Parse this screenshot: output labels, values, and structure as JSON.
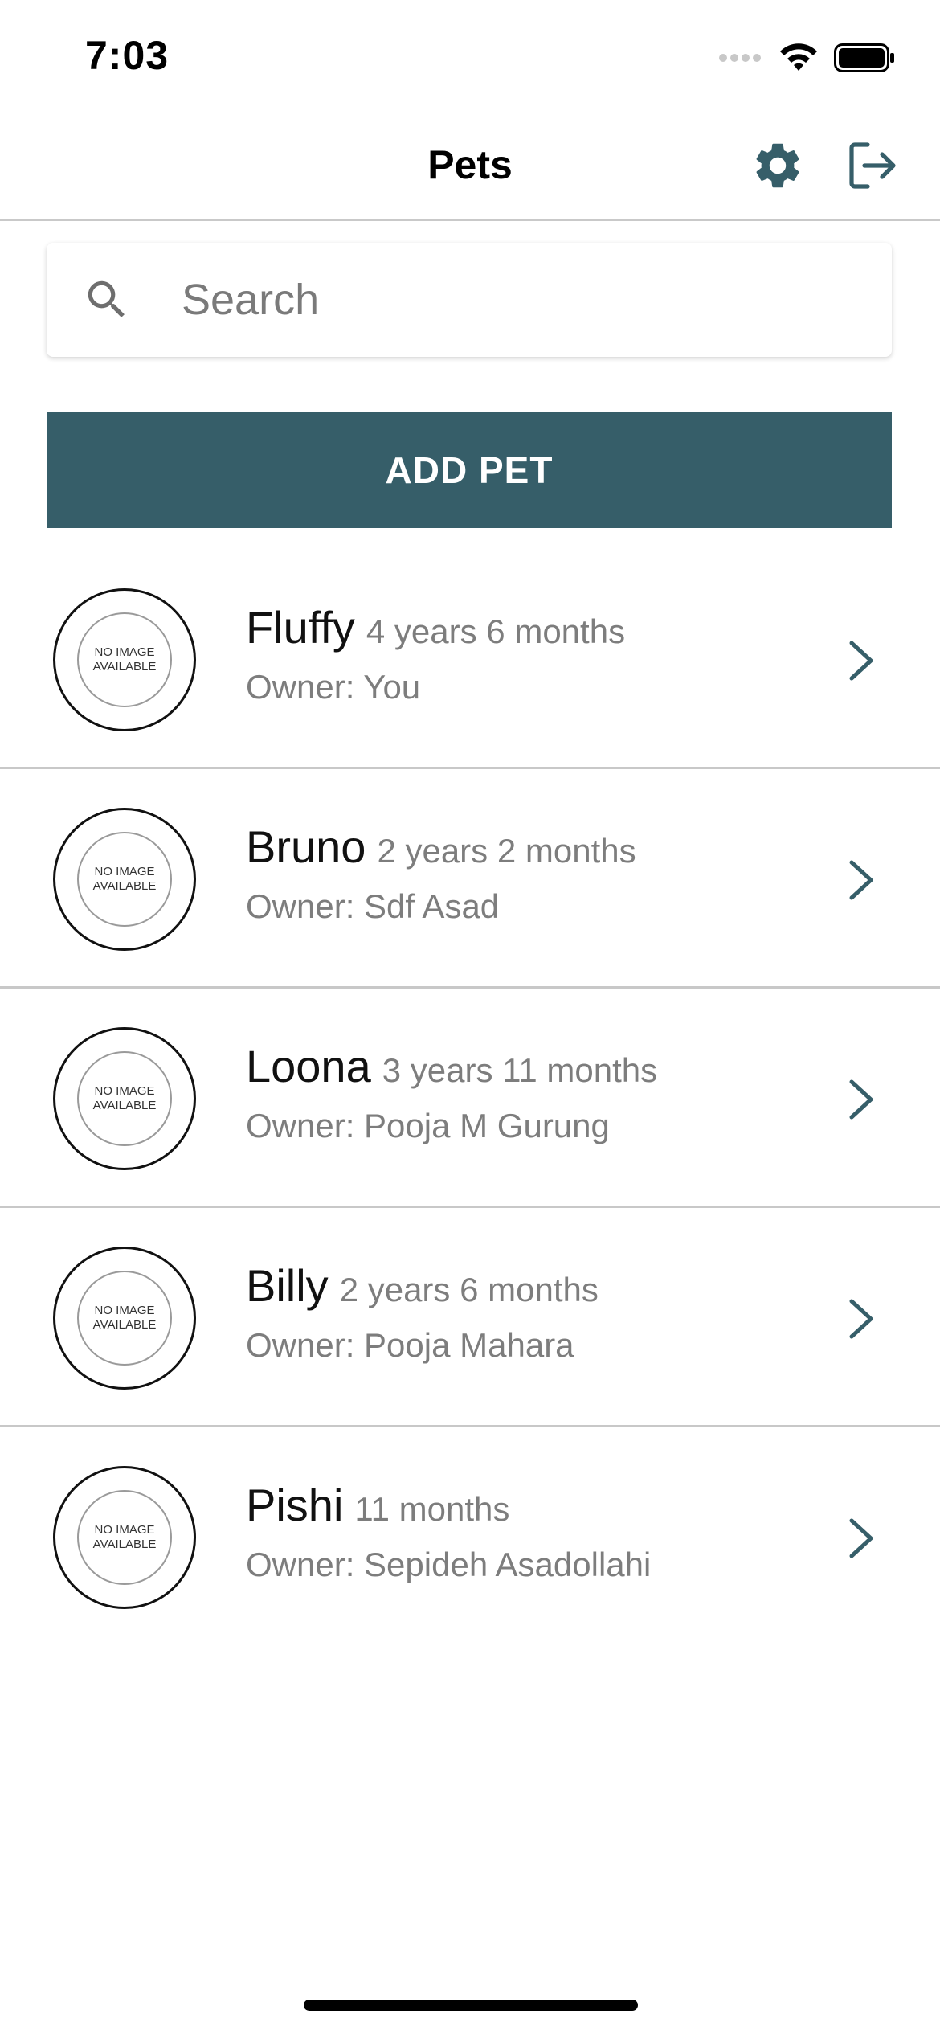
{
  "status_bar": {
    "time": "7:03"
  },
  "nav": {
    "title": "Pets",
    "settings_icon": "gear-icon",
    "logout_icon": "logout-icon"
  },
  "search": {
    "placeholder": "Search",
    "value": ""
  },
  "add_button": {
    "label": "ADD PET"
  },
  "colors": {
    "accent": "#365e69",
    "secondary_text": "#7d7d7d",
    "divider": "#c8c8c8"
  },
  "placeholder_image_text": "NO IMAGE\nAVAILABLE",
  "pets": [
    {
      "name": "Fluffy",
      "age": "4 years 6 months",
      "owner": "Owner: You"
    },
    {
      "name": "Bruno",
      "age": "2 years 2 months",
      "owner": "Owner: Sdf Asad"
    },
    {
      "name": "Loona",
      "age": "3 years 11 months",
      "owner": "Owner: Pooja M Gurung"
    },
    {
      "name": "Billy",
      "age": "2 years 6 months",
      "owner": "Owner: Pooja Mahara"
    },
    {
      "name": "Pishi",
      "age": "11 months",
      "owner": "Owner: Sepideh Asadollahi"
    }
  ]
}
